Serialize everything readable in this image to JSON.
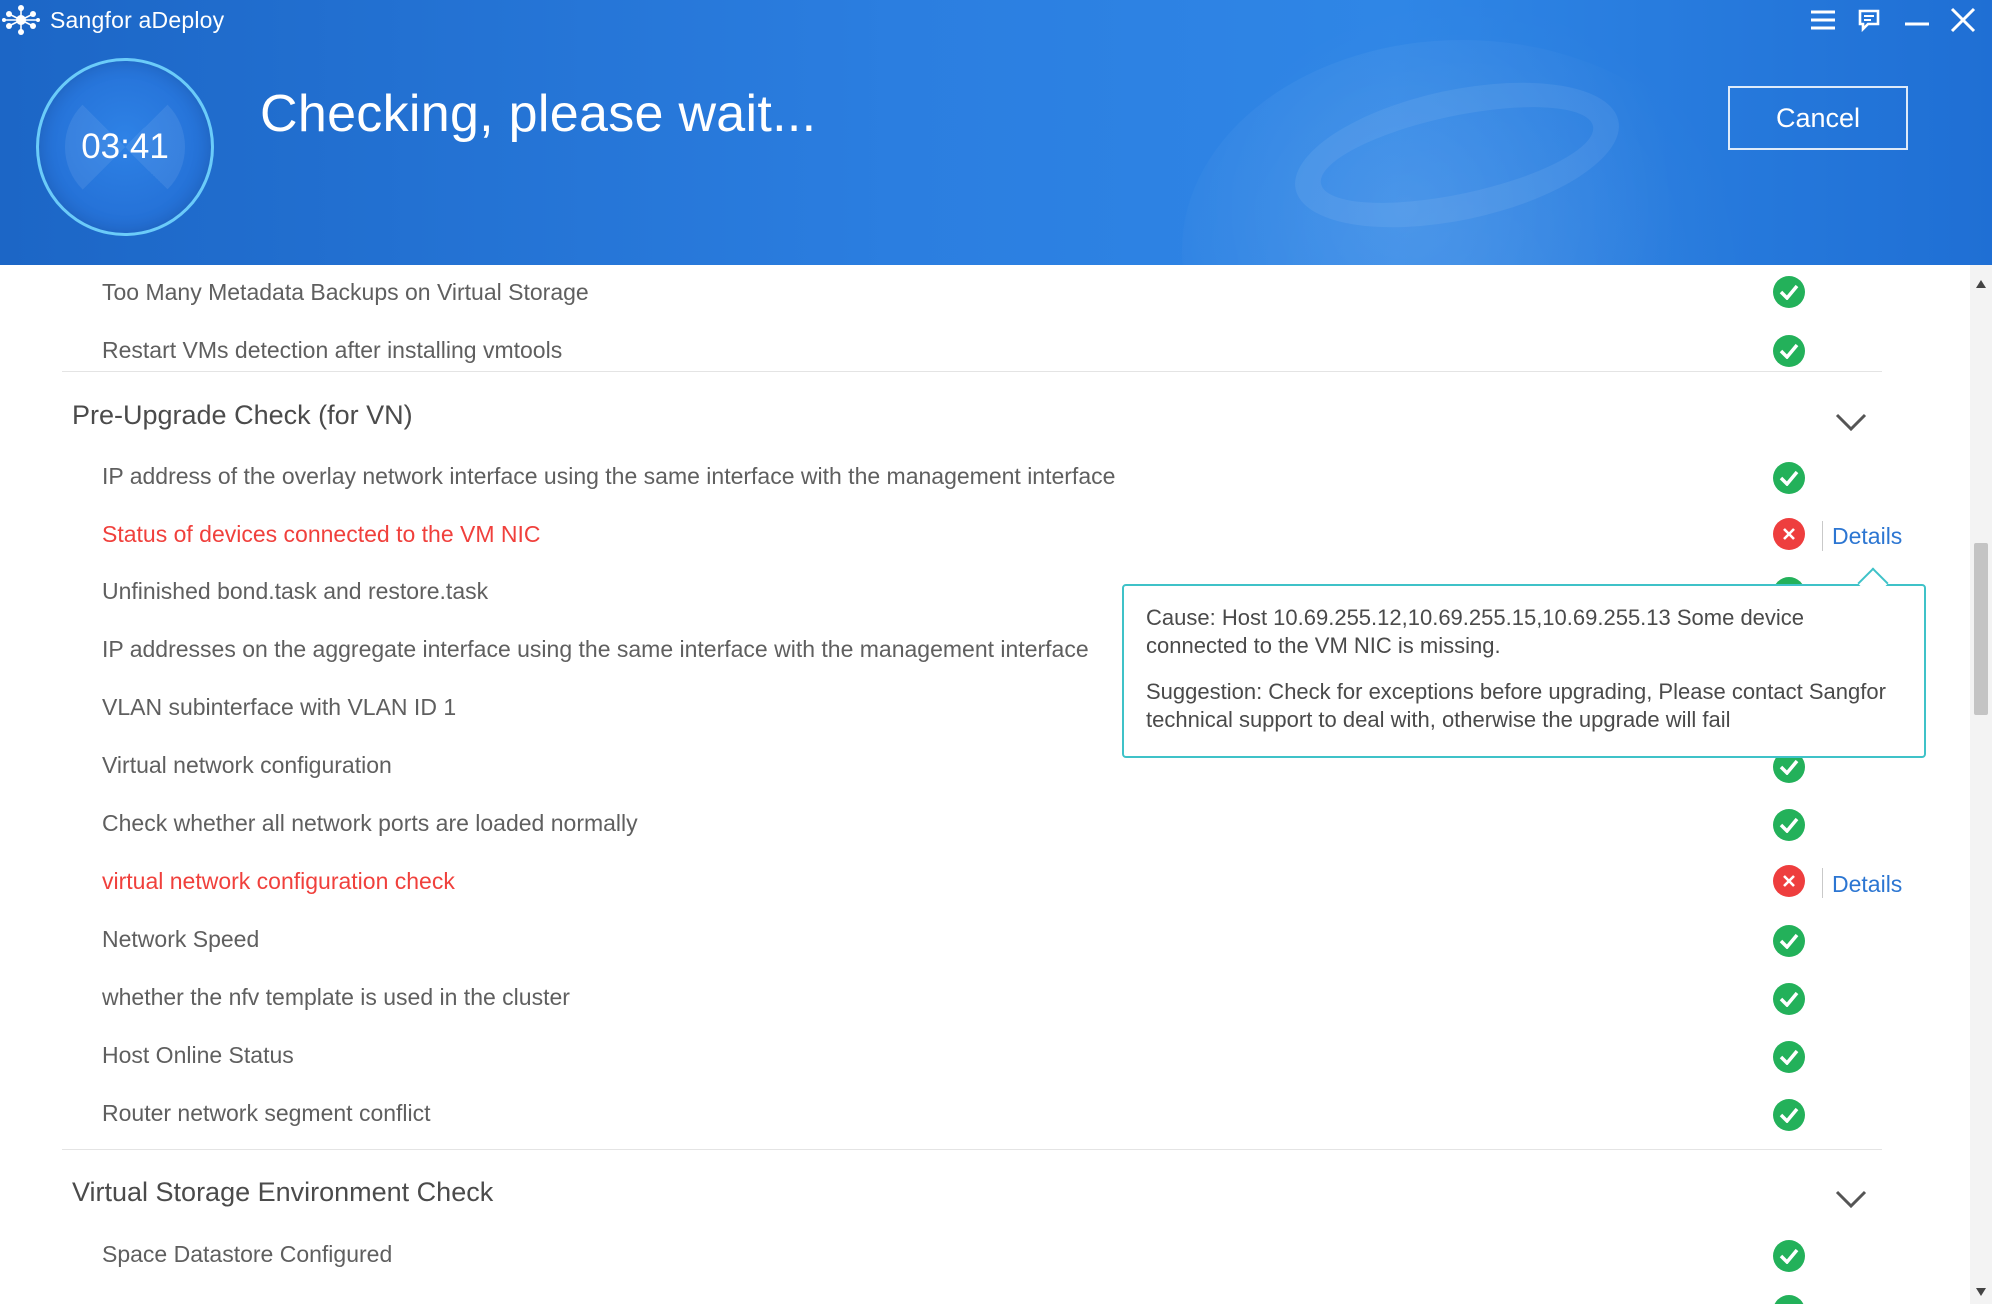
{
  "app": {
    "title": "Sangfor aDeploy"
  },
  "header": {
    "timer": "03:41",
    "status_title": "Checking, please wait...",
    "cancel_label": "Cancel"
  },
  "colors": {
    "header_blue": "#2b7ee0",
    "ok_green": "#23b15a",
    "error_red": "#ee3e3e",
    "fail_text_red": "#f0403c",
    "link_blue": "#2c76d2",
    "tooltip_border": "#3fc2c8"
  },
  "top_items": [
    {
      "label": "Too Many Metadata Backups on Virtual Storage",
      "status": "ok"
    },
    {
      "label": "Restart VMs detection after installing vmtools",
      "status": "ok"
    }
  ],
  "sections": [
    {
      "title": "Pre-Upgrade Check (for VN)",
      "items": [
        {
          "label": "IP address of the overlay network interface using the same interface with the management interface",
          "status": "ok"
        },
        {
          "label": "Status of devices connected to the VM NIC",
          "status": "error",
          "details": "Details"
        },
        {
          "label": "Unfinished bond.task and restore.task",
          "status": "ok"
        },
        {
          "label": "IP addresses on the aggregate interface using the same interface with the management interface",
          "status": "ok"
        },
        {
          "label": "VLAN subinterface with VLAN ID 1",
          "status": "ok"
        },
        {
          "label": "Virtual network configuration",
          "status": "ok"
        },
        {
          "label": "Check whether all network ports are loaded normally",
          "status": "ok"
        },
        {
          "label": "virtual network configuration check",
          "status": "error",
          "details": "Details"
        },
        {
          "label": "Network Speed",
          "status": "ok"
        },
        {
          "label": "whether the nfv template is used in the cluster",
          "status": "ok"
        },
        {
          "label": "Host Online Status",
          "status": "ok"
        },
        {
          "label": "Router network segment conflict",
          "status": "ok"
        }
      ]
    },
    {
      "title": "Virtual Storage Environment Check",
      "items": [
        {
          "label": "Space Datastore Configured",
          "status": "ok"
        }
      ]
    }
  ],
  "tooltip": {
    "cause": "Cause: Host 10.69.255.12,10.69.255.15,10.69.255.13 Some device connected to the VM NIC is missing.",
    "suggestion": "Suggestion: Check for exceptions before upgrading, Please contact Sangfor technical support to deal with, otherwise the upgrade will fail"
  }
}
